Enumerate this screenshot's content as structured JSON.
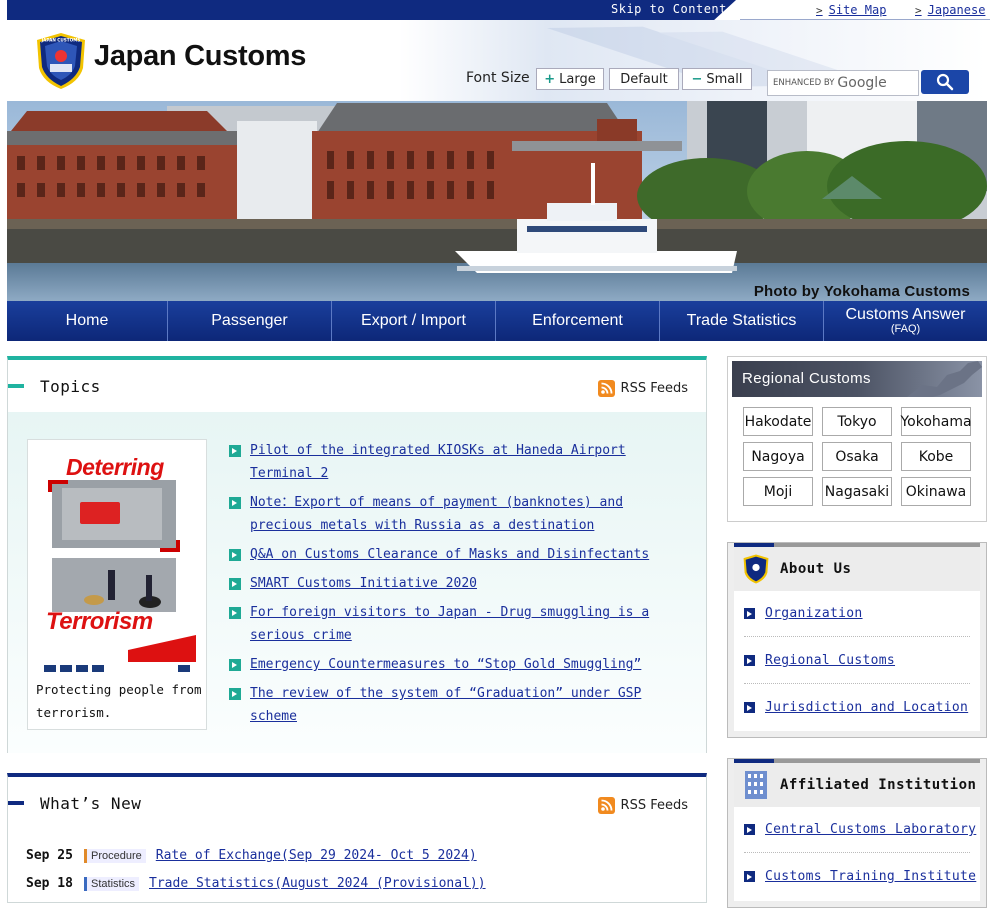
{
  "topbar": {
    "skip": "Skip to Content",
    "sitemap": "Site Map",
    "japanese": "Japanese"
  },
  "header": {
    "title": "Japan Customs",
    "font_size_label": "Font Size",
    "font_large": "Large",
    "font_default": "Default",
    "font_small": "Small",
    "search_enhanced": "ENHANCED BY",
    "search_brand": "Google"
  },
  "hero": {
    "credit": "Photo by Yokohama Customs"
  },
  "nav": [
    {
      "label": "Home"
    },
    {
      "label": "Passenger"
    },
    {
      "label": "Export / Import"
    },
    {
      "label": "Enforcement"
    },
    {
      "label": "Trade Statistics"
    },
    {
      "label": "Customs Answer",
      "sub": "(FAQ)"
    }
  ],
  "topics": {
    "title": "Topics",
    "rss": "RSS Feeds",
    "poster": {
      "top": "Deterring",
      "bottom": "Terrorism",
      "caption": "Protecting people from terrorism."
    },
    "items": [
      "Pilot of the integrated KIOSKs at Haneda Airport Terminal 2",
      "Note：Export of means of payment (banknotes) and precious metals with Russia as a destination",
      "Q&A on Customs Clearance of Masks and Disinfectants",
      "SMART Customs Initiative 2020",
      "For foreign visitors to Japan - Drug smuggling is a serious crime",
      "Emergency Countermeasures to “Stop Gold Smuggling”",
      "The review of the system of “Graduation” under GSP scheme"
    ]
  },
  "whatsnew": {
    "title": "What’s New",
    "rss": "RSS Feeds",
    "items": [
      {
        "date": "Sep 25",
        "tag": "Procedure",
        "text": "Rate of Exchange(Sep 29 2024- Oct 5 2024)"
      },
      {
        "date": "Sep 18",
        "tag": "Statistics",
        "text": "Trade Statistics(August 2024 (Provisional))"
      }
    ]
  },
  "regional": {
    "title": "Regional Customs",
    "cities": [
      "Hakodate",
      "Tokyo",
      "Yokohama",
      "Nagoya",
      "Osaka",
      "Kobe",
      "Moji",
      "Nagasaki",
      "Okinawa"
    ]
  },
  "about": {
    "title": "About Us",
    "items": [
      "Organization",
      "Regional Customs",
      "Jurisdiction and Location"
    ]
  },
  "affiliated": {
    "title": "Affiliated Institution",
    "items": [
      "Central Customs Laboratory",
      "Customs Training Institute"
    ]
  },
  "colors": {
    "navy": "#0f2a80",
    "teal": "#1fb3a0",
    "rss_orange": "#f18a1f"
  }
}
